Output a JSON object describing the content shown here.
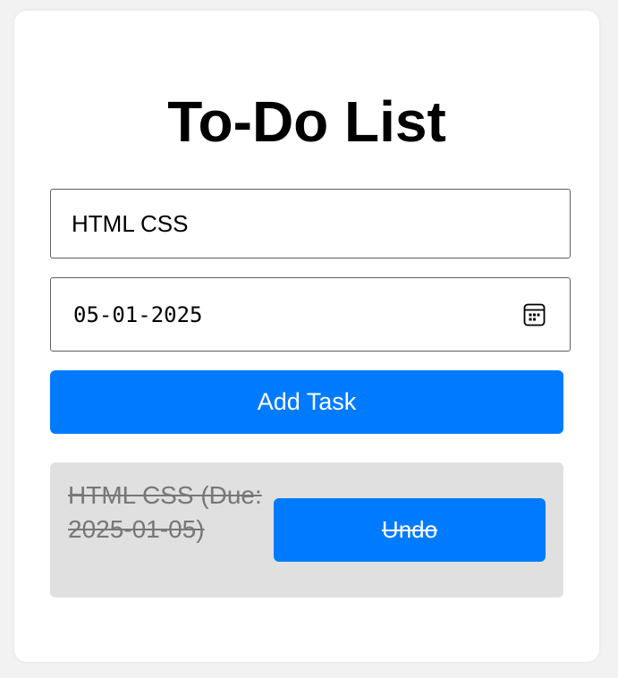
{
  "app": {
    "title": "To-Do List"
  },
  "form": {
    "task_value": "HTML CSS",
    "date_value": "05-01-2025",
    "add_label": "Add Task"
  },
  "tasks": [
    {
      "text": "HTML CSS (Due: 2025-01-05)",
      "completed": true,
      "action_label": "Undo"
    }
  ],
  "icons": {
    "date_picker": "calendar-icon"
  },
  "colors": {
    "accent": "#007bff",
    "task_background": "#e0e0e0",
    "completed_text": "#777777"
  }
}
